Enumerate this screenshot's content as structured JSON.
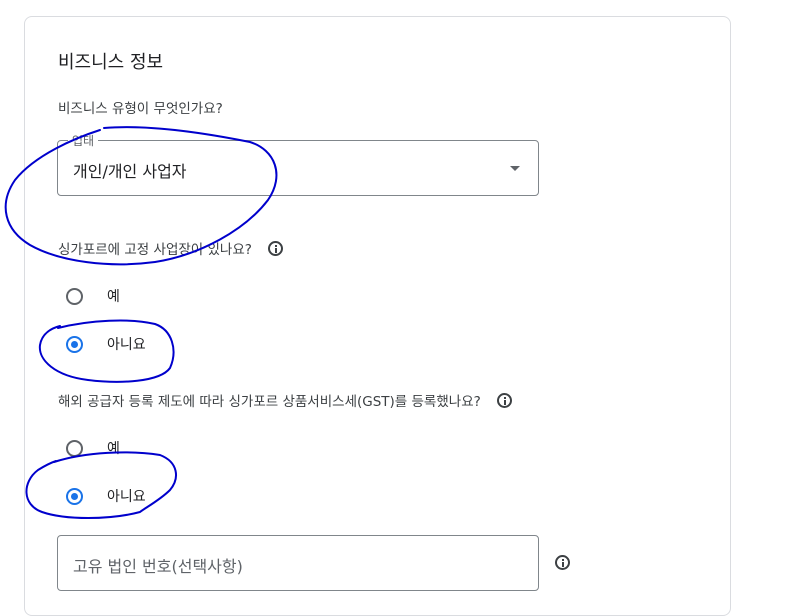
{
  "section": {
    "title": "비즈니스 정보"
  },
  "business_type": {
    "question": "비즈니스 유형이 무엇인가요?",
    "legend": "업태",
    "selected": "개인/개인 사업자"
  },
  "fixed_location": {
    "question": "싱가포르에 고정 사업장이 있나요?",
    "options": [
      {
        "label": "예",
        "checked": false
      },
      {
        "label": "아니요",
        "checked": true
      }
    ]
  },
  "gst": {
    "question": "해외 공급자 등록 제도에 따라 싱가포르 상품서비스세(GST)를 등록했나요?",
    "options": [
      {
        "label": "예",
        "checked": false
      },
      {
        "label": "아니요",
        "checked": true
      }
    ]
  },
  "uen": {
    "placeholder": "고유 법인 번호(선택사항)"
  },
  "colors": {
    "accent": "#1a73e8",
    "annotation": "#0000cc"
  }
}
